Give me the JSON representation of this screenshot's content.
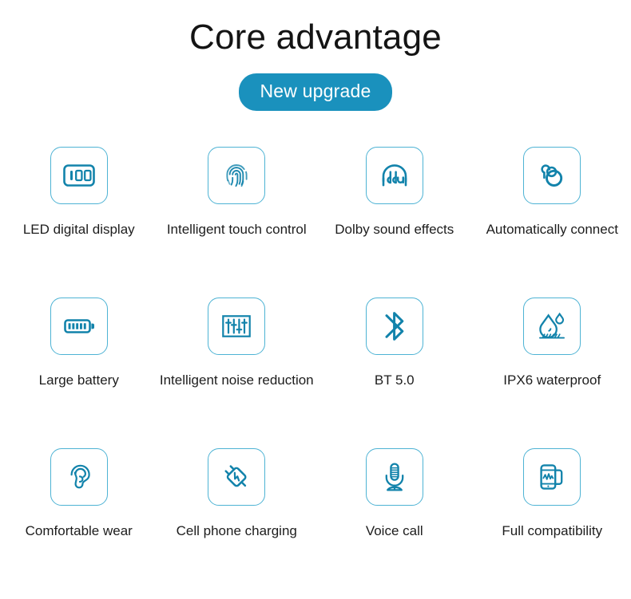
{
  "header": {
    "title": "Core advantage",
    "badge_label": "New upgrade",
    "badge_color": "#1a91bd",
    "title_color": "#141414"
  },
  "theme": {
    "icon_stroke": "#1283ab",
    "icon_card_border": "#4eb3d4",
    "accent": "#1a91bd",
    "background": "#ffffff",
    "label_color": "#1d1d1d"
  },
  "features": [
    {
      "icon": "led-digital-display-icon",
      "label": "LED digital display",
      "value": "100"
    },
    {
      "icon": "fingerprint-icon",
      "label": "Intelligent touch control",
      "value": ""
    },
    {
      "icon": "dolby-headphone-icon",
      "label": "Dolby sound effects",
      "value": "ddub"
    },
    {
      "icon": "auto-connect-earbuds-icon",
      "label": "Automatically connect",
      "value": ""
    },
    {
      "icon": "battery-icon",
      "label": "Large battery",
      "value": ""
    },
    {
      "icon": "equalizer-sliders-icon",
      "label": "Intelligent noise reduction",
      "value": ""
    },
    {
      "icon": "bluetooth-icon",
      "label": "BT 5.0",
      "value": ""
    },
    {
      "icon": "waterproof-droplet-icon",
      "label": "IPX6 waterproof",
      "value": ""
    },
    {
      "icon": "ear-icon",
      "label": "Comfortable wear",
      "value": ""
    },
    {
      "icon": "charging-plug-icon",
      "label": "Cell phone charging",
      "value": ""
    },
    {
      "icon": "microphone-icon",
      "label": "Voice call",
      "value": ""
    },
    {
      "icon": "phone-compatibility-icon",
      "label": "Full compatibility",
      "value": ""
    }
  ]
}
